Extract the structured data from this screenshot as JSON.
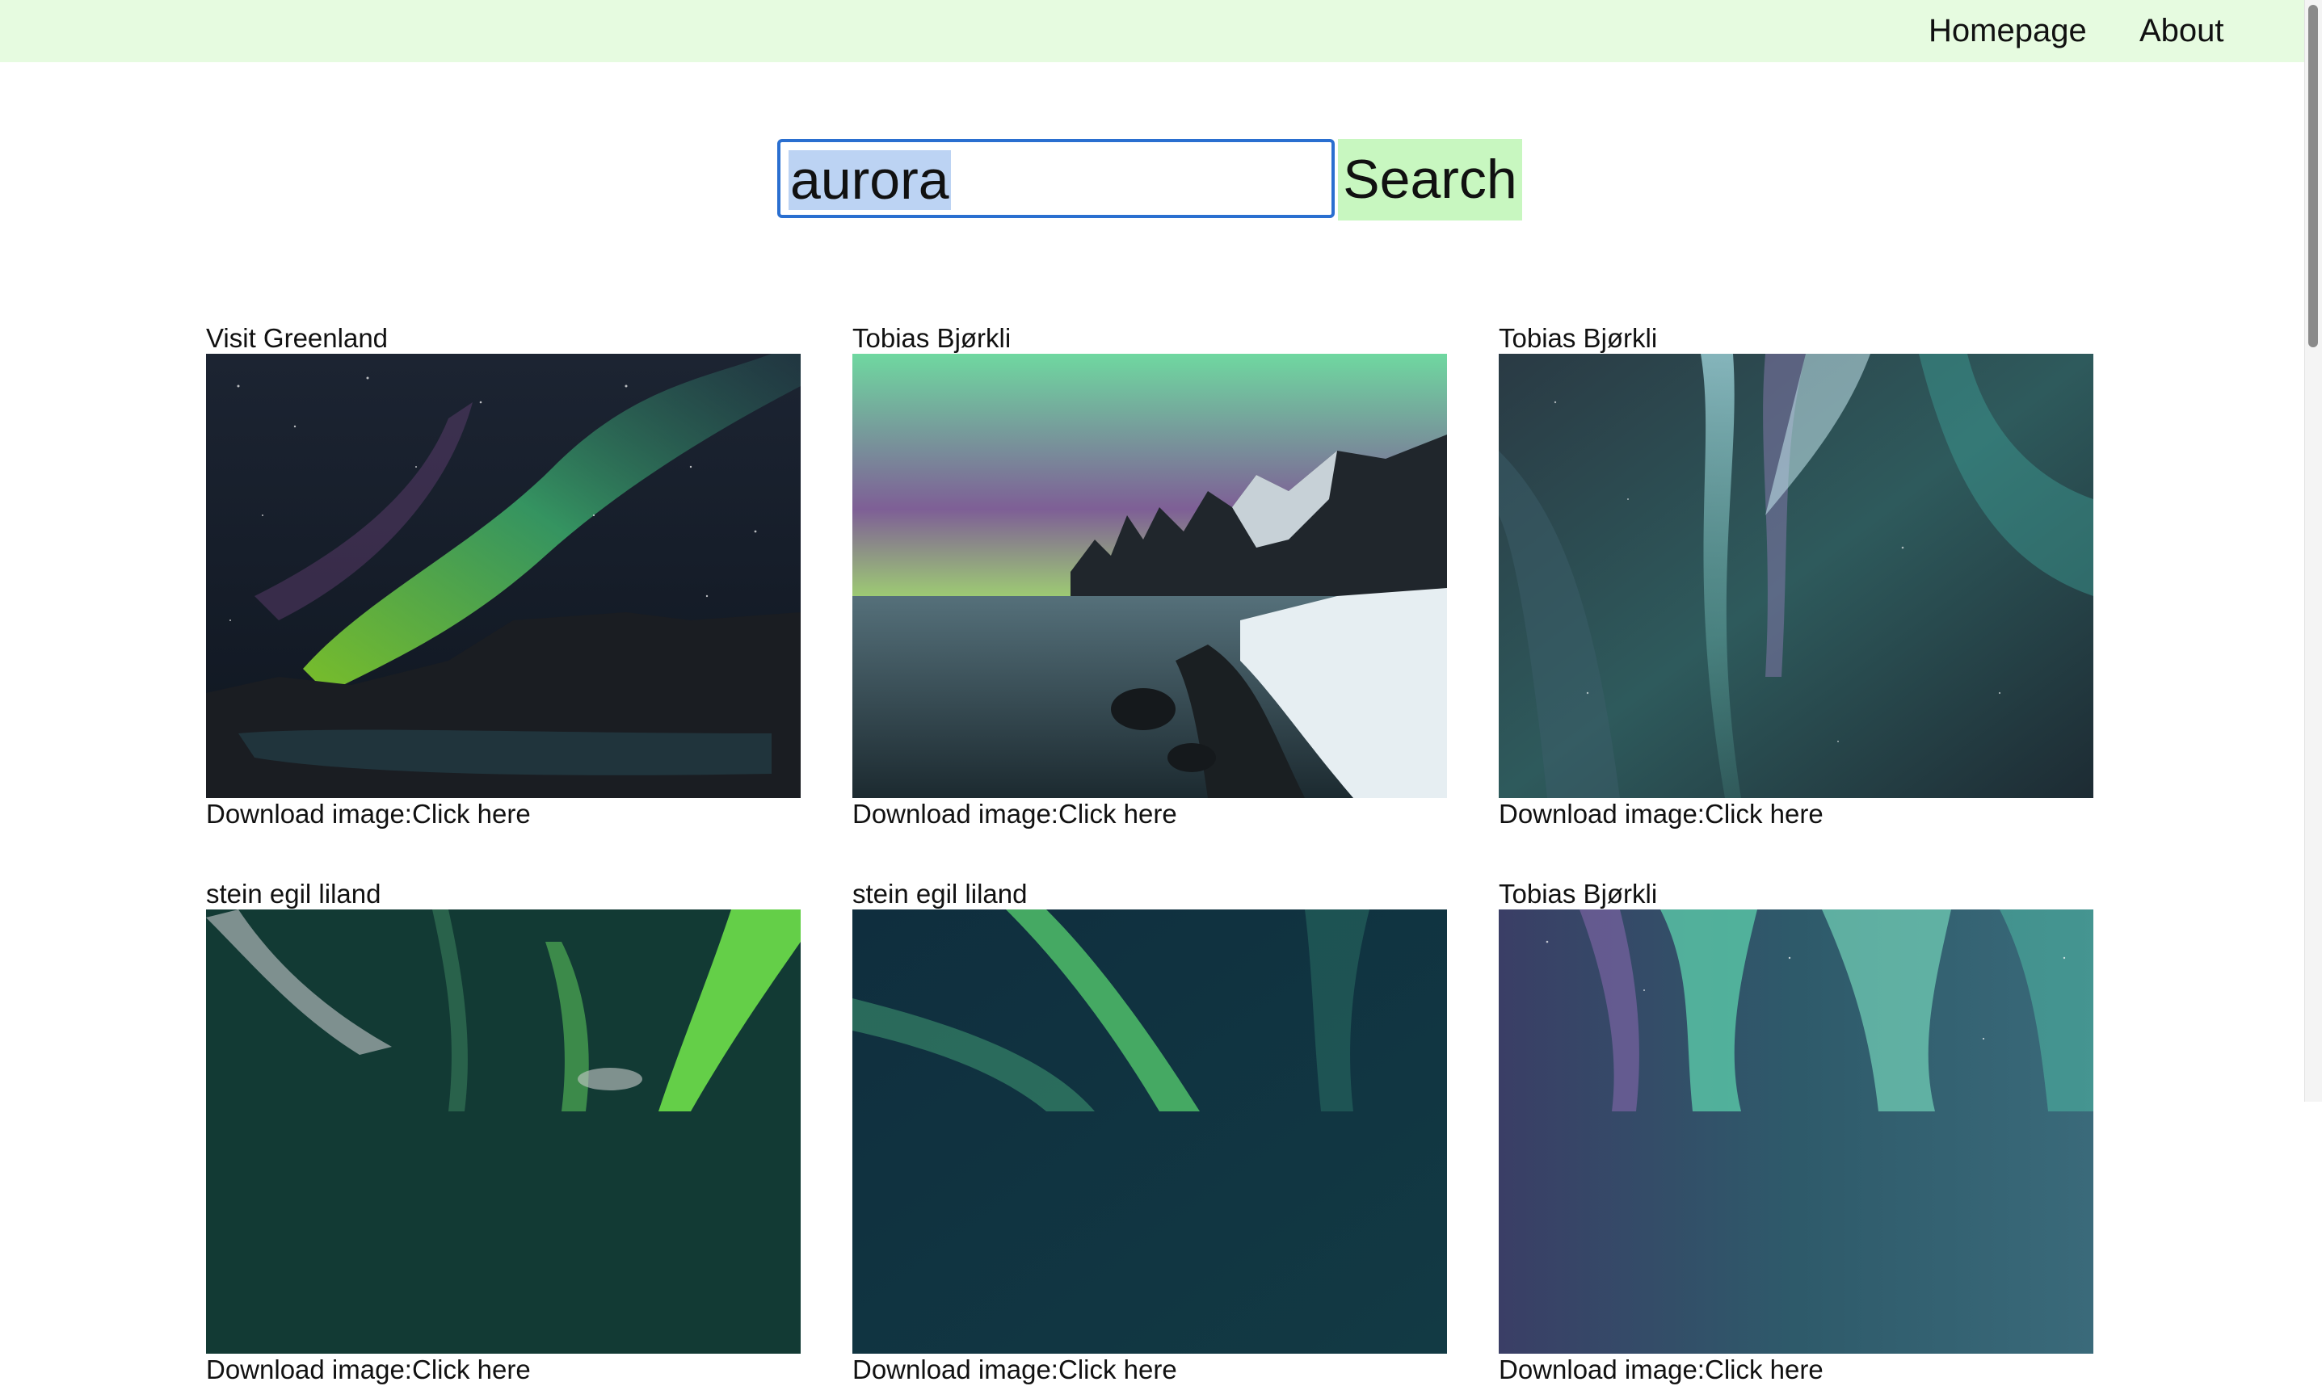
{
  "nav": {
    "homepage": "Homepage",
    "about": "About",
    "background_color": "#e6fbe0"
  },
  "search": {
    "value": "aurora",
    "button_label": "Search",
    "button_color": "#c8f7c0",
    "focus_border_color": "#2a6fd0",
    "selection_color": "#bcd3f3"
  },
  "results": [
    {
      "author": "Visit Greenland",
      "download_prefix": "Download image:",
      "download_link": "Click here",
      "image": "aurora-over-fjord-night-sky"
    },
    {
      "author": "Tobias Bjørkli",
      "download_prefix": "Download image:",
      "download_link": "Click here",
      "image": "aurora-over-snowy-mountain-coast"
    },
    {
      "author": "Tobias Bjørkli",
      "download_prefix": "Download image:",
      "download_link": "Click here",
      "image": "aurora-curtains-teal"
    },
    {
      "author": "stein egil liland",
      "download_prefix": "Download image:",
      "download_link": "Click here",
      "image": "aurora-green-streaks"
    },
    {
      "author": "stein egil liland",
      "download_prefix": "Download image:",
      "download_link": "Click here",
      "image": "aurora-green-arc"
    },
    {
      "author": "Tobias Bjørkli",
      "download_prefix": "Download image:",
      "download_link": "Click here",
      "image": "aurora-teal-starry"
    }
  ]
}
